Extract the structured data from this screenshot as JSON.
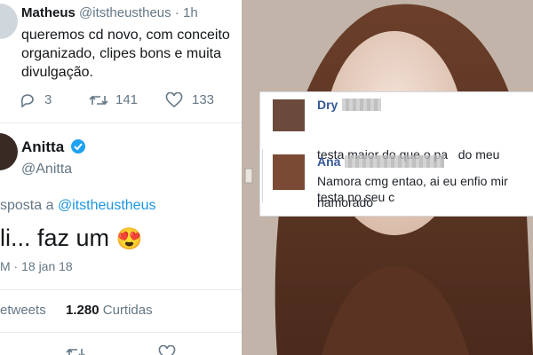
{
  "tweet1": {
    "name": "Matheus",
    "handle": "@itstheustheus",
    "time": "· 1h",
    "lines": [
      "queremos cd novo, com conceito",
      "organizado, clipes bons e muita",
      "divulgação."
    ],
    "replies": "3",
    "retweets": "141",
    "likes": "133"
  },
  "tweet2": {
    "name": "Anitta",
    "handle": "@Anitta",
    "reply_prefix": "sposta a",
    "reply_to": "@itstheustheus",
    "text": "li... faz um",
    "emoji": "😍",
    "timestamp": "M · 18 jan 18",
    "retweets_label": "etweets",
    "likes_count": "1.280",
    "likes_label": "Curtidas"
  },
  "comments": [
    {
      "author": "Dry",
      "lines": [
        "testa maior do que o pa   do meu",
        "namorado"
      ]
    },
    {
      "author": "Ana",
      "lines": [
        "Namora cmg entao, ai eu enfio mir",
        "testa no seu c"
      ]
    }
  ],
  "colors": {
    "verified": "#1da1f2",
    "link": "#1b95e0",
    "muted": "#657786",
    "fb_name": "#365899"
  }
}
